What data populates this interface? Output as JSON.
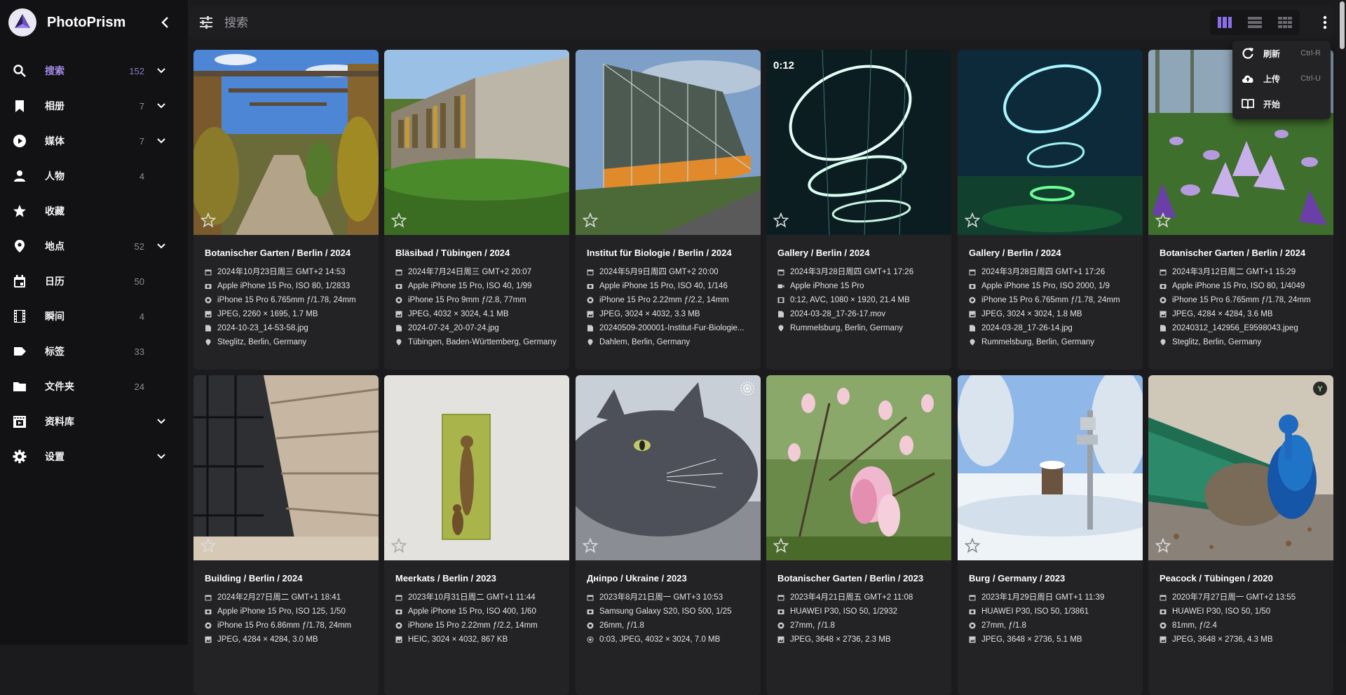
{
  "app": {
    "name": "PhotoPrism"
  },
  "sidebar": {
    "items": [
      {
        "label": "搜索",
        "count": "152",
        "icon": "search-icon",
        "expand": true,
        "active": true
      },
      {
        "label": "相册",
        "count": "7",
        "icon": "bookmark-icon",
        "expand": true
      },
      {
        "label": "媒体",
        "count": "7",
        "icon": "play-circle-icon",
        "expand": true
      },
      {
        "label": "人物",
        "count": "4",
        "icon": "person-icon",
        "expand": false
      },
      {
        "label": "收藏",
        "count": "",
        "icon": "star-icon",
        "expand": false
      },
      {
        "label": "地点",
        "count": "52",
        "icon": "map-pin-icon",
        "expand": true
      },
      {
        "label": "日历",
        "count": "50",
        "icon": "calendar-icon",
        "expand": false
      },
      {
        "label": "瞬间",
        "count": "4",
        "icon": "film-icon",
        "expand": false
      },
      {
        "label": "标签",
        "count": "33",
        "icon": "tag-icon",
        "expand": false
      },
      {
        "label": "文件夹",
        "count": "24",
        "icon": "folder-icon",
        "expand": false
      },
      {
        "label": "资料库",
        "count": "",
        "icon": "library-icon",
        "expand": true
      },
      {
        "label": "设置",
        "count": "",
        "icon": "gear-icon",
        "expand": true
      }
    ]
  },
  "search": {
    "placeholder": "搜索"
  },
  "menu": {
    "items": [
      {
        "label": "刷新",
        "shortcut": "Ctrl-R",
        "icon": "refresh-icon"
      },
      {
        "label": "上传",
        "shortcut": "Ctrl-U",
        "icon": "cloud-upload-icon"
      },
      {
        "label": "开始",
        "shortcut": "",
        "icon": "book-open-icon"
      }
    ]
  },
  "photos": [
    {
      "title": "Botanischer Garten / Berlin / 2024",
      "date": "2024年10月23日周三 GMT+2 14:53",
      "camera": "Apple iPhone 15 Pro, ISO 80, 1/2833",
      "lens": "iPhone 15 Pro 6.765mm ƒ/1.78, 24mm",
      "file": "JPEG, 2260 × 1695, 1.7 MB",
      "name": "2024-10-23_14-53-58.jpg",
      "location": "Steglitz, Berlin, Germany"
    },
    {
      "title": "Bläsibad / Tübingen / 2024",
      "date": "2024年7月24日周三 GMT+2 20:07",
      "camera": "Apple iPhone 15 Pro, ISO 40, 1/99",
      "lens": "iPhone 15 Pro 9mm ƒ/2.8, 77mm",
      "file": "JPEG, 4032 × 3024, 4.1 MB",
      "name": "2024-07-24_20-07-24.jpg",
      "location": "Tübingen, Baden-Württemberg, Germany"
    },
    {
      "title": "Institut für Biologie / Berlin / 2024",
      "date": "2024年5月9日周四 GMT+2 20:00",
      "camera": "Apple iPhone 15 Pro, ISO 40, 1/146",
      "lens": "iPhone 15 Pro 2.22mm ƒ/2.2, 14mm",
      "file": "JPEG, 3024 × 4032, 3.3 MB",
      "name": "20240509-200001-Institut-Fur-Biologie...",
      "location": "Dahlem, Berlin, Germany"
    },
    {
      "title": "Gallery / Berlin / 2024",
      "duration": "0:12",
      "date": "2024年3月28日周四 GMT+1 17:26",
      "camera": "Apple iPhone 15 Pro",
      "file": "0:12, AVC, 1080 × 1920, 21.4 MB",
      "name": "2024-03-28_17-26-17.mov",
      "location": "Rummelsburg, Berlin, Germany"
    },
    {
      "title": "Gallery / Berlin / 2024",
      "date": "2024年3月28日周四 GMT+1 17:26",
      "camera": "Apple iPhone 15 Pro, ISO 2000, 1/9",
      "lens": "iPhone 15 Pro 6.765mm ƒ/1.78, 24mm",
      "file": "JPEG, 3024 × 3024, 1.8 MB",
      "name": "2024-03-28_17-26-14.jpg",
      "location": "Rummelsburg, Berlin, Germany"
    },
    {
      "title": "Botanischer Garten / Berlin / 2024",
      "date": "2024年3月12日周二 GMT+1 15:29",
      "camera": "Apple iPhone 15 Pro, ISO 80, 1/4049",
      "lens": "iPhone 15 Pro 6.765mm ƒ/1.78, 24mm",
      "file": "JPEG, 4284 × 4284, 3.6 MB",
      "name": "20240312_142956_E9598043.jpeg",
      "location": "Steglitz, Berlin, Germany"
    },
    {
      "title": "Building / Berlin / 2024",
      "date": "2024年2月27日周二 GMT+1 18:41",
      "camera": "Apple iPhone 15 Pro, ISO 125, 1/50",
      "lens": "iPhone 15 Pro 6.86mm ƒ/1.78, 24mm",
      "file": "JPEG, 4284 × 4284, 3.0 MB"
    },
    {
      "title": "Meerkats / Berlin / 2023",
      "date": "2023年10月31日周二 GMT+1 11:44",
      "camera": "Apple iPhone 15 Pro, ISO 400, 1/60",
      "lens": "iPhone 15 Pro 2.22mm ƒ/2.2, 14mm",
      "file": "HEIC, 3024 × 4032, 867 KB"
    },
    {
      "title": "Дніпро / Ukraine / 2023",
      "date": "2023年8月21日周一 GMT+3 10:53",
      "camera": "Samsung Galaxy S20, ISO 500, 1/25",
      "lens": "26mm, ƒ/1.8",
      "file": "0:03, JPEG, 4032 × 3024, 7.0 MB"
    },
    {
      "title": "Botanischer Garten / Berlin / 2023",
      "date": "2023年4月21日周五 GMT+2 11:08",
      "camera": "HUAWEI P30, ISO 50, 1/2932",
      "lens": "27mm, ƒ/1.8",
      "file": "JPEG, 3648 × 2736, 2.3 MB"
    },
    {
      "title": "Burg / Germany / 2023",
      "date": "2023年1月29日周日 GMT+1 11:39",
      "camera": "HUAWEI P30, ISO 50, 1/3861",
      "lens": "27mm, ƒ/1.8",
      "file": "JPEG, 3648 × 2736, 5.1 MB"
    },
    {
      "title": "Peacock / Tübingen / 2020",
      "date": "2020年7月27日周一 GMT+2 13:55",
      "camera": "HUAWEI P30, ISO 50, 1/50",
      "lens": "81mm, ƒ/2.4",
      "file": "JPEG, 3648 × 2736, 4.3 MB"
    }
  ],
  "colors": {
    "accent": "#a58ae8",
    "sidebar_bg": "#121214",
    "card_bg": "#232325"
  }
}
